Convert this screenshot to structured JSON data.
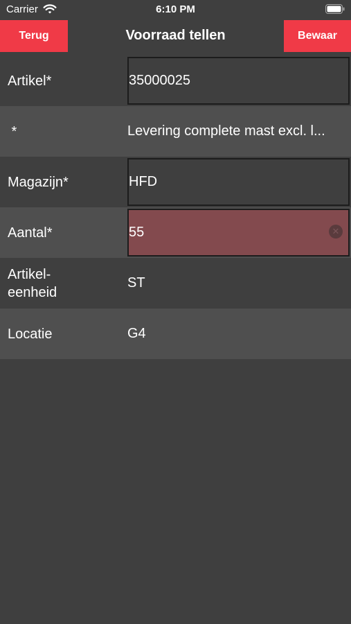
{
  "status_bar": {
    "carrier": "Carrier",
    "time": "6:10 PM"
  },
  "nav": {
    "back_label": "Terug",
    "title": "Voorraad tellen",
    "save_label": "Bewaar",
    "accent_color": "#f03a47"
  },
  "form": {
    "rows": [
      {
        "label": "Artikel*",
        "value": "35000025"
      },
      {
        "label": " *",
        "value": "Levering complete mast excl. l..."
      },
      {
        "label": "Magazijn*",
        "value": "HFD"
      },
      {
        "label": "Aantal*",
        "value": "55"
      },
      {
        "label": "Artikel-\neenheid",
        "value": "ST"
      },
      {
        "label": "Locatie",
        "value": "G4"
      }
    ]
  },
  "icons": {
    "wifi": "wifi-icon",
    "battery": "battery-icon",
    "clear": "clear-text-icon"
  }
}
